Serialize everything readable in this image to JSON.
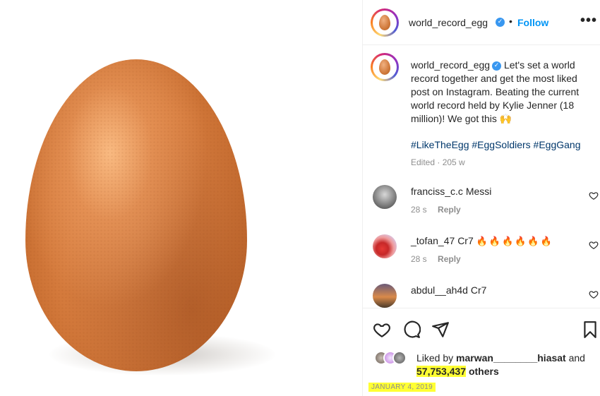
{
  "post": {
    "username": "world_record_egg",
    "verified_glyph": "✓",
    "dot": "•",
    "follow_label": "Follow",
    "more_label": "•••",
    "caption_text": "Let's set a world record together and get the most liked post on Instagram. Beating the current world record held by Kylie Jenner (18 million)! We got this 🙌",
    "hashtags": "#LikeTheEgg #EggSoldiers #EggGang",
    "edited": "Edited · 205 w"
  },
  "comments": [
    {
      "user": "franciss_c.c",
      "text": "Messi",
      "time": "28 s",
      "reply": "Reply"
    },
    {
      "user": "_tofan_47",
      "text": "Cr7",
      "flames": "🔥🔥🔥🔥🔥🔥",
      "time": "28 s",
      "reply": "Reply"
    },
    {
      "user": "abdul__ah4d",
      "text": "Cr7"
    }
  ],
  "likes": {
    "prefix": "Liked by",
    "user": "marwan________hiasat",
    "and": "and",
    "count": "57,753,437",
    "suffix": "others"
  },
  "date": "JANUARY 4, 2019",
  "icons": {
    "like": "heart-icon",
    "comment": "comment-icon",
    "share": "send-icon",
    "save": "bookmark-icon",
    "comment_like": "heart-outline-icon"
  },
  "colors": {
    "follow": "#0095f6",
    "verified": "#3897f0",
    "hashtag": "#00376b",
    "highlight": "#ffff33"
  }
}
